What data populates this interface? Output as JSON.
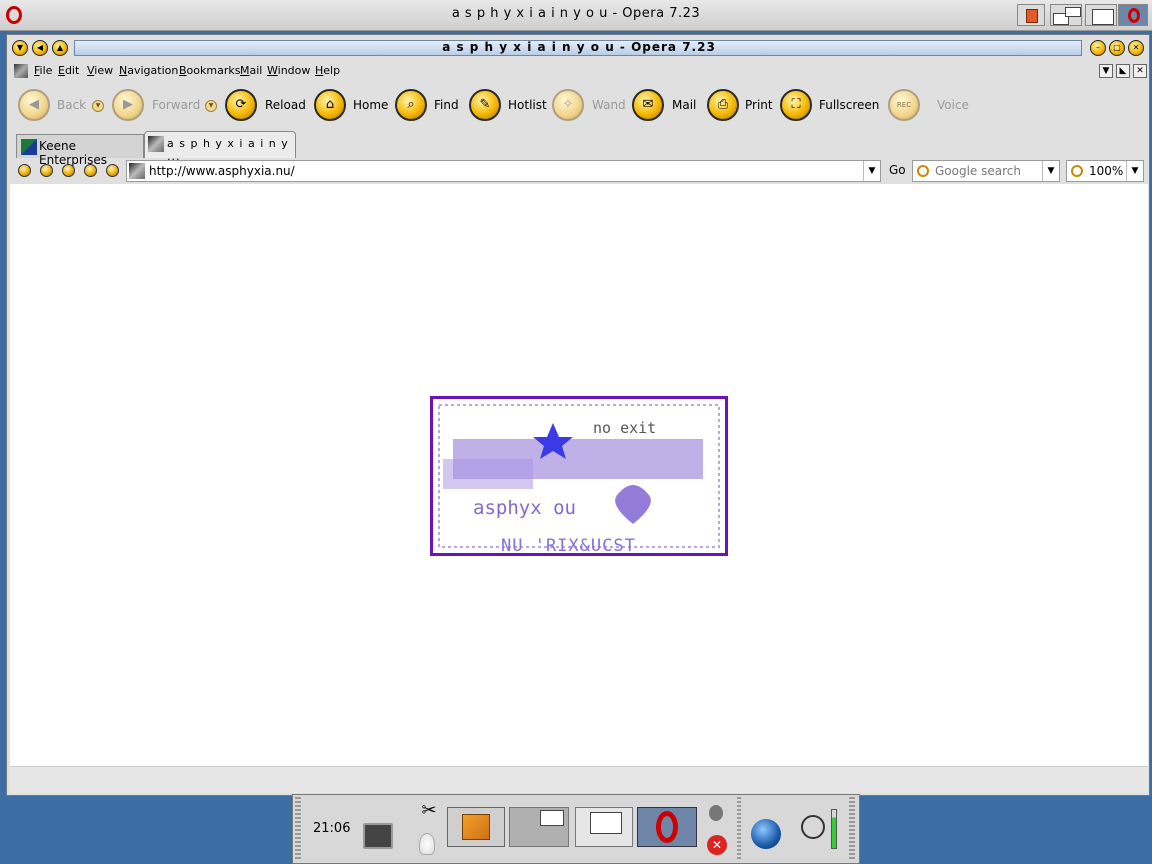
{
  "outer_window": {
    "title": "a s p h y x i a i n y o u - Opera 7.23"
  },
  "window": {
    "title": "a s p h y x i a i n y o u - Opera 7.23"
  },
  "menu": [
    "File",
    "Edit",
    "View",
    "Navigation",
    "Bookmarks",
    "Mail",
    "Window",
    "Help"
  ],
  "toolbar": {
    "back": "Back",
    "forward": "Forward",
    "reload": "Reload",
    "home": "Home",
    "find": "Find",
    "hotlist": "Hotlist",
    "wand": "Wand",
    "mail": "Mail",
    "print": "Print",
    "fullscreen": "Fullscreen",
    "rec": "REC",
    "voice": "Voice"
  },
  "tabs": [
    {
      "label": "Keene Enterprises",
      "active": false
    },
    {
      "label": "a s p h y x i a i n y ...",
      "active": true
    }
  ],
  "address": {
    "url": "http://www.asphyxia.nu/",
    "go_label": "Go",
    "search_placeholder": "Google search",
    "zoom": "100%"
  },
  "page_image": {
    "text_top": "no exit",
    "text_mid": "asphyx   ou",
    "text_bottom": "NU 'RIX&UCST"
  },
  "taskbar": {
    "clock": "21:06"
  },
  "colors": {
    "accent": "#f5b800",
    "image_border": "#6a13b8",
    "desktop": "#3a6ea5"
  }
}
